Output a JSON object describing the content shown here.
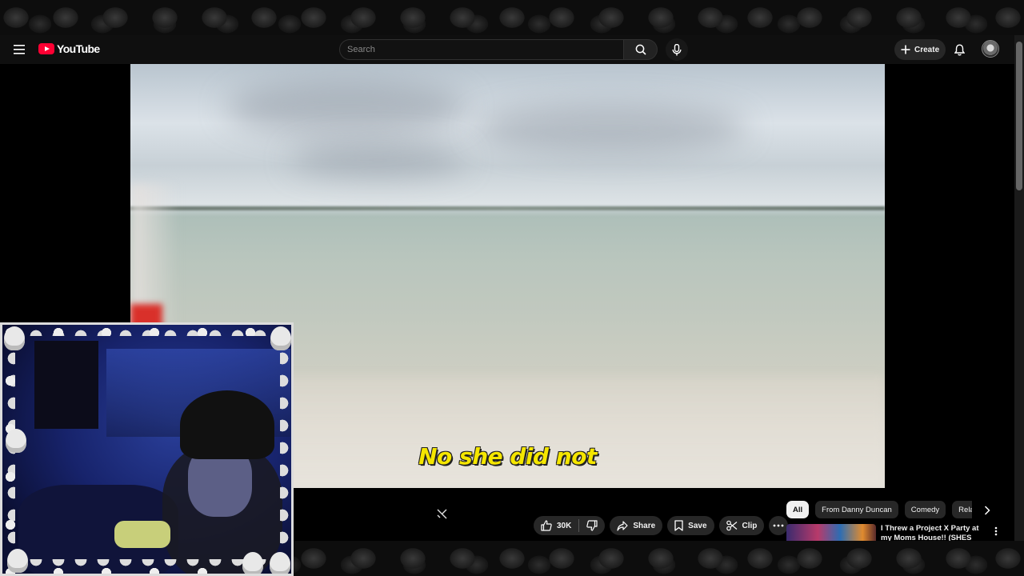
{
  "masthead": {
    "logo_text": "YouTube",
    "search": {
      "placeholder": "Search",
      "value": ""
    },
    "create_label": "Create",
    "icons": [
      "menu-icon",
      "search-icon",
      "microphone-icon",
      "plus-icon",
      "bell-icon",
      "avatar"
    ]
  },
  "player": {
    "caption": "No she did not"
  },
  "actions": {
    "like_count": "30K",
    "share_label": "Share",
    "save_label": "Save",
    "clip_label": "Clip"
  },
  "chips": [
    {
      "label": "All",
      "active": true
    },
    {
      "label": "From Danny Duncan",
      "active": false
    },
    {
      "label": "Comedy",
      "active": false
    },
    {
      "label": "Related",
      "active": false
    }
  ],
  "related": {
    "first_title": "I Threw a Project X Party at my Moms House!! (SHES PISSED)"
  },
  "colors": {
    "accent_red": "#ff0033",
    "caption_yellow": "#f5e600",
    "chip_active_bg": "#f1f1f1",
    "pill_bg": "#272727"
  }
}
